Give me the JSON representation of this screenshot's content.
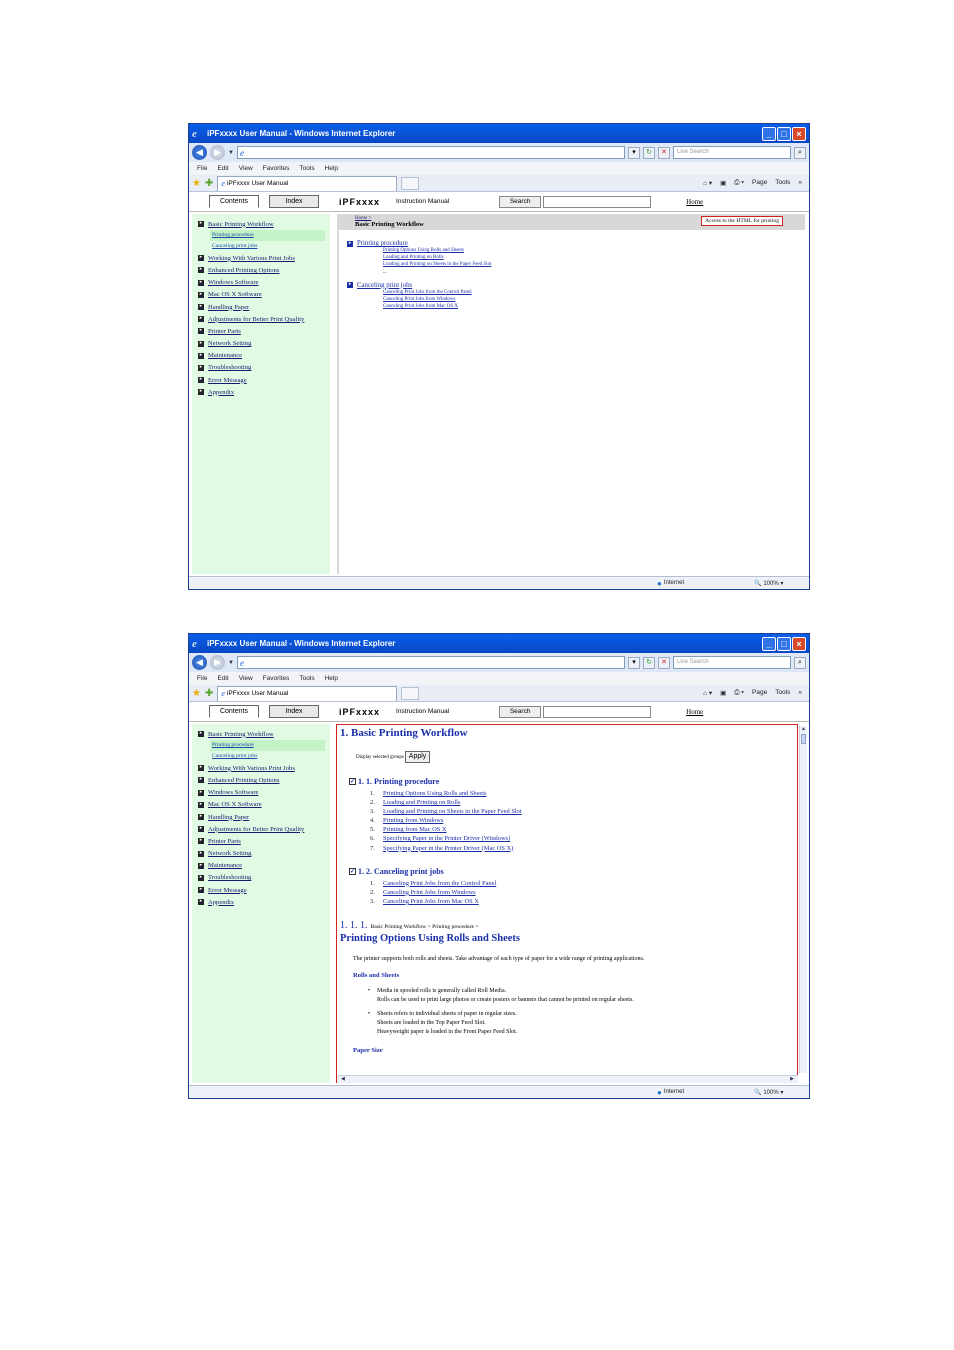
{
  "browser": {
    "window_title": "iPFxxxx User Manual - Windows Internet Explorer",
    "live_search_placeholder": "Live Search",
    "menu": [
      "File",
      "Edit",
      "View",
      "Favorites",
      "Tools",
      "Help"
    ],
    "tab_title": "iPFxxxx User Manual",
    "cmd_page": "Page",
    "cmd_tools": "Tools",
    "status_zone": "Internet",
    "zoom": "100%"
  },
  "manual": {
    "tab_contents": "Contents",
    "tab_index": "Index",
    "brand": "iPFxxxx",
    "title": "Instruction Manual",
    "search_label": "Search",
    "home_link": "Home"
  },
  "sidebar": {
    "items": [
      "Basic Printing Workflow",
      "Working With Various Print Jobs",
      "Enhanced Printing Options",
      "Windows Software",
      "Mac OS X Software",
      "Handling Paper",
      "Adjustments for Better Print Quality",
      "Printer Parts",
      "Network Setting",
      "Maintenance",
      "Troubleshooting",
      "Error Message",
      "Appendix"
    ],
    "sub_items": [
      "Printing procedure",
      "Canceling print jobs"
    ]
  },
  "page1": {
    "crumb_home": "Home >",
    "page_title": "Basic Printing Workflow",
    "access_link": "Access to the HTML for printing",
    "sections": [
      {
        "title": "Printing procedure",
        "links": [
          "Printing Options Using Rolls and Sheets",
          "Loading and Printing on Rolls",
          "Loading and Printing on Sheets in the Paper Feed Slot"
        ]
      },
      {
        "title": "Canceling print jobs",
        "links": [
          "Canceling Print Jobs from the Control Panel",
          "Canceling Print Jobs from Windows",
          "Canceling Print Jobs from Mac OS X"
        ]
      }
    ]
  },
  "page2": {
    "heading": "1. Basic Printing Workflow",
    "display_groups": "Display selected groups",
    "apply": "Apply",
    "group1": {
      "title": "1. 1. Printing procedure",
      "items": [
        "Printing Options Using Rolls and Sheets",
        "Loading and Printing on Rolls",
        "Loading and Printing on Sheets in the Paper Feed Slot",
        "Printing from Windows",
        "Printing from Mac OS X",
        "Specifying Paper in the Printer Driver (Windows)",
        "Specifying Paper in the Printer Driver (Mac OS X)"
      ]
    },
    "group2": {
      "title": "1. 2. Canceling print jobs",
      "items": [
        "Canceling Print Jobs from the Control Panel",
        "Canceling Print Jobs from Windows",
        "Canceling Print Jobs from Mac OS X"
      ]
    },
    "section_number": "1. 1. 1.",
    "section_crumb": "Basic Printing Workflow > Printing procedure >",
    "section_title": "Printing Options Using Rolls and Sheets",
    "intro": "The printer supports both rolls and sheets. Take advantage of each type of paper for a wide range of printing applications.",
    "subhead1": "Rolls and Sheets",
    "bullet1": [
      "Media in spooled rolls is generally called Roll Media.",
      "Rolls can be used to print large photos or create posters or banners that cannot be printed on regular sheets."
    ],
    "bullet2": [
      "Sheets refers to individual sheets of paper in regular sizes.",
      "Sheets are loaded in the Top Paper Feed Slot.",
      "Heavyweight paper is loaded in the Front Paper Feed Slot."
    ],
    "subhead2": "Paper Size"
  }
}
